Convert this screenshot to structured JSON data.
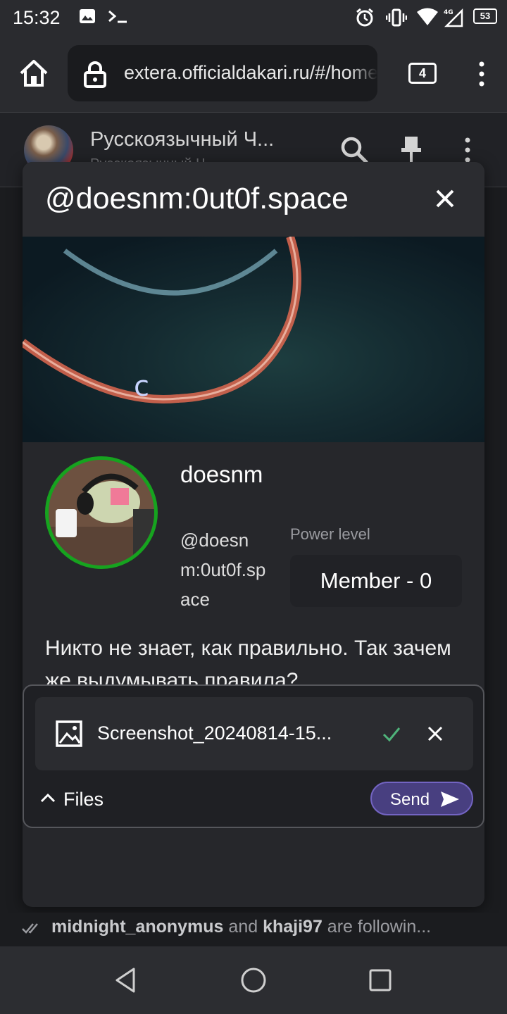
{
  "status_bar": {
    "time": "15:32",
    "network": "4G",
    "battery": "53"
  },
  "browser": {
    "url": "extera.officialdakari.ru/#/home",
    "tabs_count": "4"
  },
  "room": {
    "name": "Русскоязычный Ч...",
    "subtitle": "Русскоязычный Ч..."
  },
  "profile_dialog": {
    "title": "@doesnm:0ut0f.space",
    "display_name": "doesnm",
    "user_id": "@doesnm:0ut0f.space",
    "power_label": "Power level",
    "power_value": "Member - 0",
    "bio": "Никто не знает, как правильно. Так зачем же выдумывать правила?"
  },
  "upload": {
    "file_name": "Screenshot_20240814-15...",
    "files_label": "Files",
    "send_label": "Send"
  },
  "following": {
    "user1": "midnight_anonymus",
    "connector": " and ",
    "user2": "khaji97",
    "suffix": " are followin..."
  },
  "colors": {
    "accent": "#483f80",
    "avatar_ring": "#16a31f",
    "check": "#4fb37a"
  }
}
